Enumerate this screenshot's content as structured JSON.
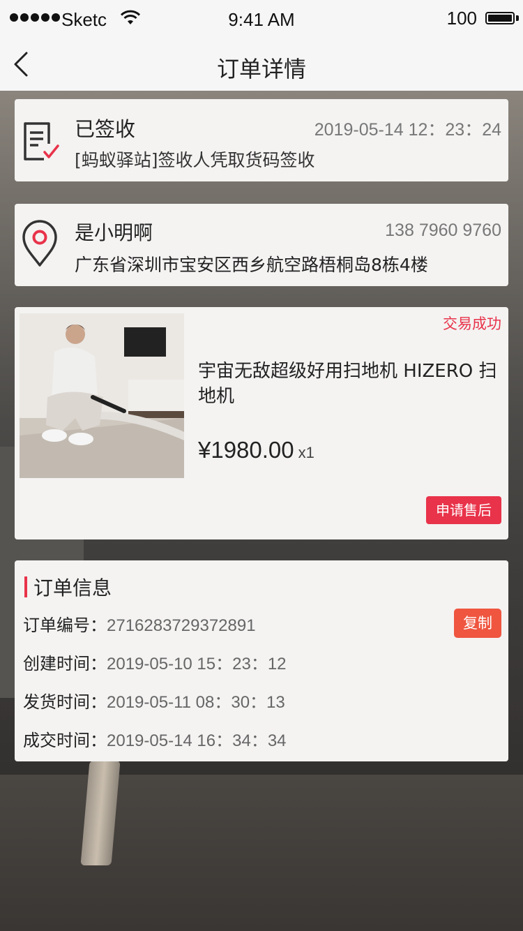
{
  "status_bar": {
    "carrier": "Sketc",
    "time": "9:41 AM",
    "battery": "100"
  },
  "nav": {
    "title": "订单详情",
    "back_icon": "chevron-left-icon"
  },
  "logistics": {
    "icon": "document-check-icon",
    "status": "已签收",
    "time": "2019-05-14  12：23：24",
    "detail": "[蚂蚁驿站]签收人凭取货码签收"
  },
  "address": {
    "icon": "location-pin-icon",
    "name": "是小明啊",
    "phone": "138 7960 9760",
    "address": "广东省深圳市宝安区西乡航空路梧桐岛8栋4楼"
  },
  "product": {
    "status": "交易成功",
    "title": "宇宙无敌超级好用扫地机 HIZERO 扫地机",
    "price": "¥1980.00",
    "quantity": "x1",
    "after_sale_label": "申请售后"
  },
  "order_info": {
    "title": "订单信息",
    "copy_label": "复制",
    "rows": [
      {
        "label": "订单编号：",
        "value": "2716283729372891"
      },
      {
        "label": "创建时间：",
        "value": "2019-05-10  15：23：12"
      },
      {
        "label": "发货时间：",
        "value": "2019-05-11  08：30：13"
      },
      {
        "label": "成交时间：",
        "value": "2019-05-14  16：34：34"
      }
    ]
  },
  "colors": {
    "accent": "#e8334a",
    "copy_button": "#ef553f",
    "card_bg": "#f4f3f2"
  }
}
